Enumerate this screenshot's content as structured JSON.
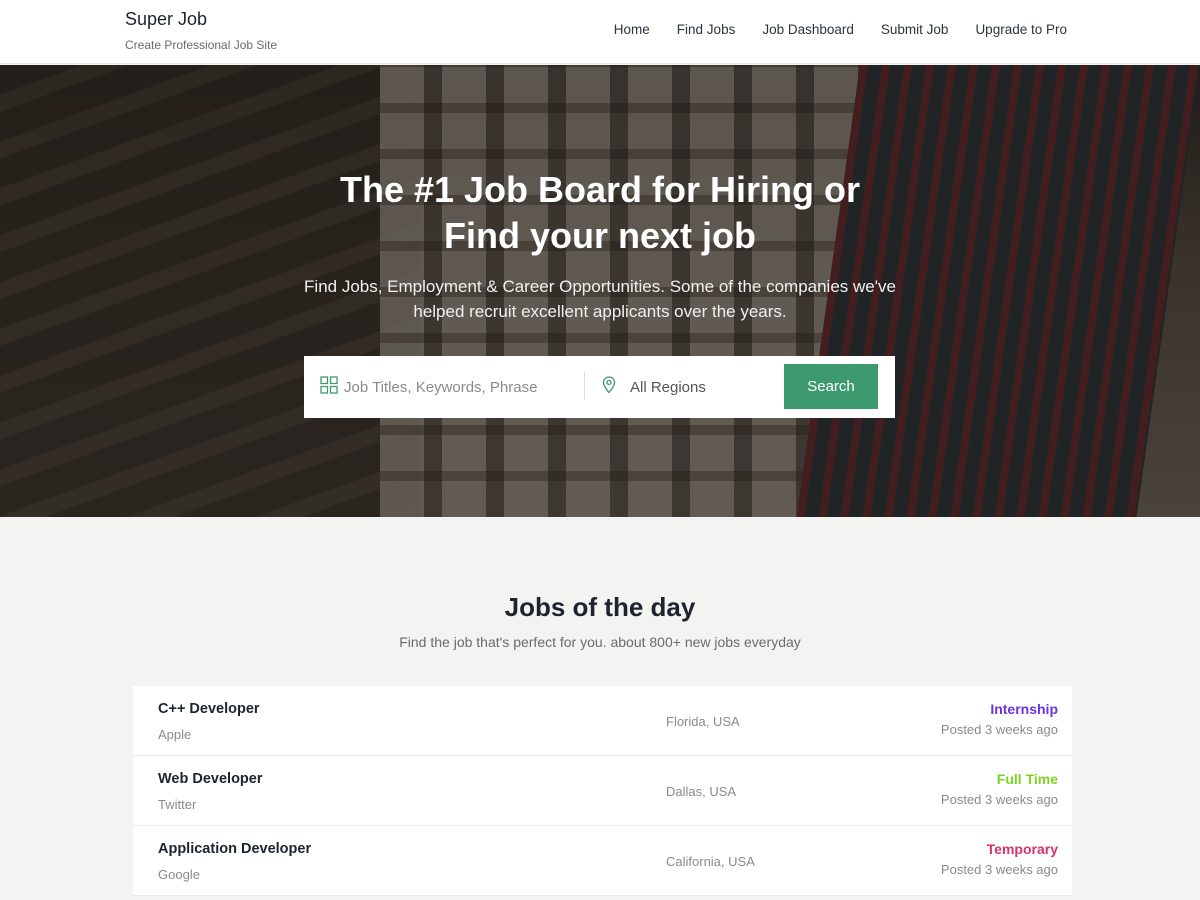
{
  "brand": {
    "title": "Super Job",
    "tagline": "Create Professional Job Site"
  },
  "nav": {
    "items": [
      "Home",
      "Find Jobs",
      "Job Dashboard",
      "Submit Job",
      "Upgrade to Pro"
    ]
  },
  "hero": {
    "title": "The #1 Job Board for Hiring or Find your next job",
    "subtitle": "Find Jobs, Employment & Career Opportunities. Some of the companies we've helped recruit excellent applicants over the years."
  },
  "search": {
    "keywords_placeholder": "Job Titles, Keywords, Phrase",
    "keywords_value": "",
    "region_value": "All Regions",
    "button_label": "Search",
    "grid_icon": "grid-icon",
    "location_icon": "map-pin-icon"
  },
  "jobs_section": {
    "title": "Jobs of the day",
    "subtitle": "Find the job that's perfect for you. about 800+ new jobs everyday",
    "jobs": [
      {
        "title": "C++ Developer",
        "company": "Apple",
        "location": "Florida, USA",
        "type": "Internship",
        "type_color": "#6c33e0",
        "posted": "Posted 3 weeks ago"
      },
      {
        "title": "Web Developer",
        "company": "Twitter",
        "location": "Dallas, USA",
        "type": "Full Time",
        "type_color": "#7ed321",
        "posted": "Posted 3 weeks ago"
      },
      {
        "title": "Application Developer",
        "company": "Google",
        "location": "California, USA",
        "type": "Temporary",
        "type_color": "#d6336c",
        "posted": "Posted 3 weeks ago"
      }
    ]
  },
  "colors": {
    "accent": "#3d9a6f",
    "background": "#f3f3f1"
  }
}
